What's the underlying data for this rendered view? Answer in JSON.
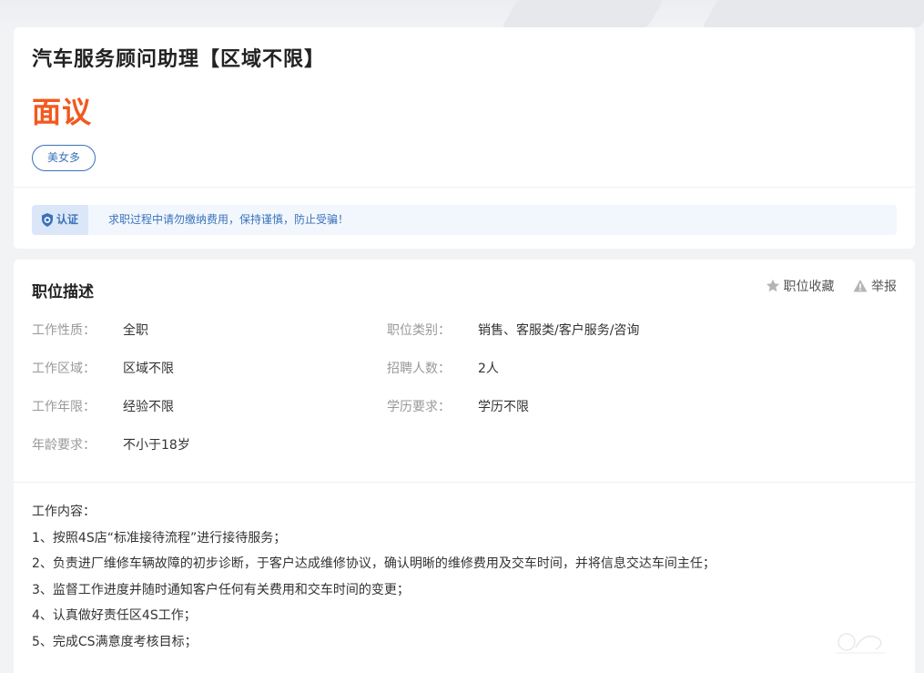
{
  "job": {
    "title": "汽车服务顾问助理【区域不限】",
    "salary": "面议",
    "tags": [
      "美女多"
    ]
  },
  "notice": {
    "badge": "认证",
    "text": "求职过程中请勿缴纳费用，保持谨慎，防止受骗！"
  },
  "description": {
    "section_title": "职位描述",
    "actions": {
      "favorite": "职位收藏",
      "report": "举报"
    },
    "fields": [
      {
        "label": "工作性质：",
        "value": "全职"
      },
      {
        "label": "职位类别：",
        "value": "销售、客服类/客户服务/咨询"
      },
      {
        "label": "工作区域：",
        "value": "区域不限"
      },
      {
        "label": "招聘人数：",
        "value": "2人"
      },
      {
        "label": "工作年限：",
        "value": "经验不限"
      },
      {
        "label": "学历要求：",
        "value": "学历不限"
      },
      {
        "label": "年龄要求：",
        "value": "不小于18岁"
      }
    ],
    "content": [
      "工作内容：",
      "1、按照4S店“标准接待流程”进行接待服务；",
      "2、负责进厂维修车辆故障的初步诊断，于客户达成维修协议，确认明晰的维修费用及交车时间，并将信息交达车间主任；",
      "3、监督工作进度并随时通知客户任何有关费用和交车时间的变更；",
      "4、认真做好责任区4S工作；",
      "5、完成CS满意度考核目标；"
    ]
  },
  "colors": {
    "salary": "#f2591e",
    "accent": "#3b72b9",
    "background": "#f2f3f5"
  },
  "icons": {
    "verify": "shield-check-icon",
    "favorite": "star-icon",
    "report": "warning-triangle-icon"
  }
}
